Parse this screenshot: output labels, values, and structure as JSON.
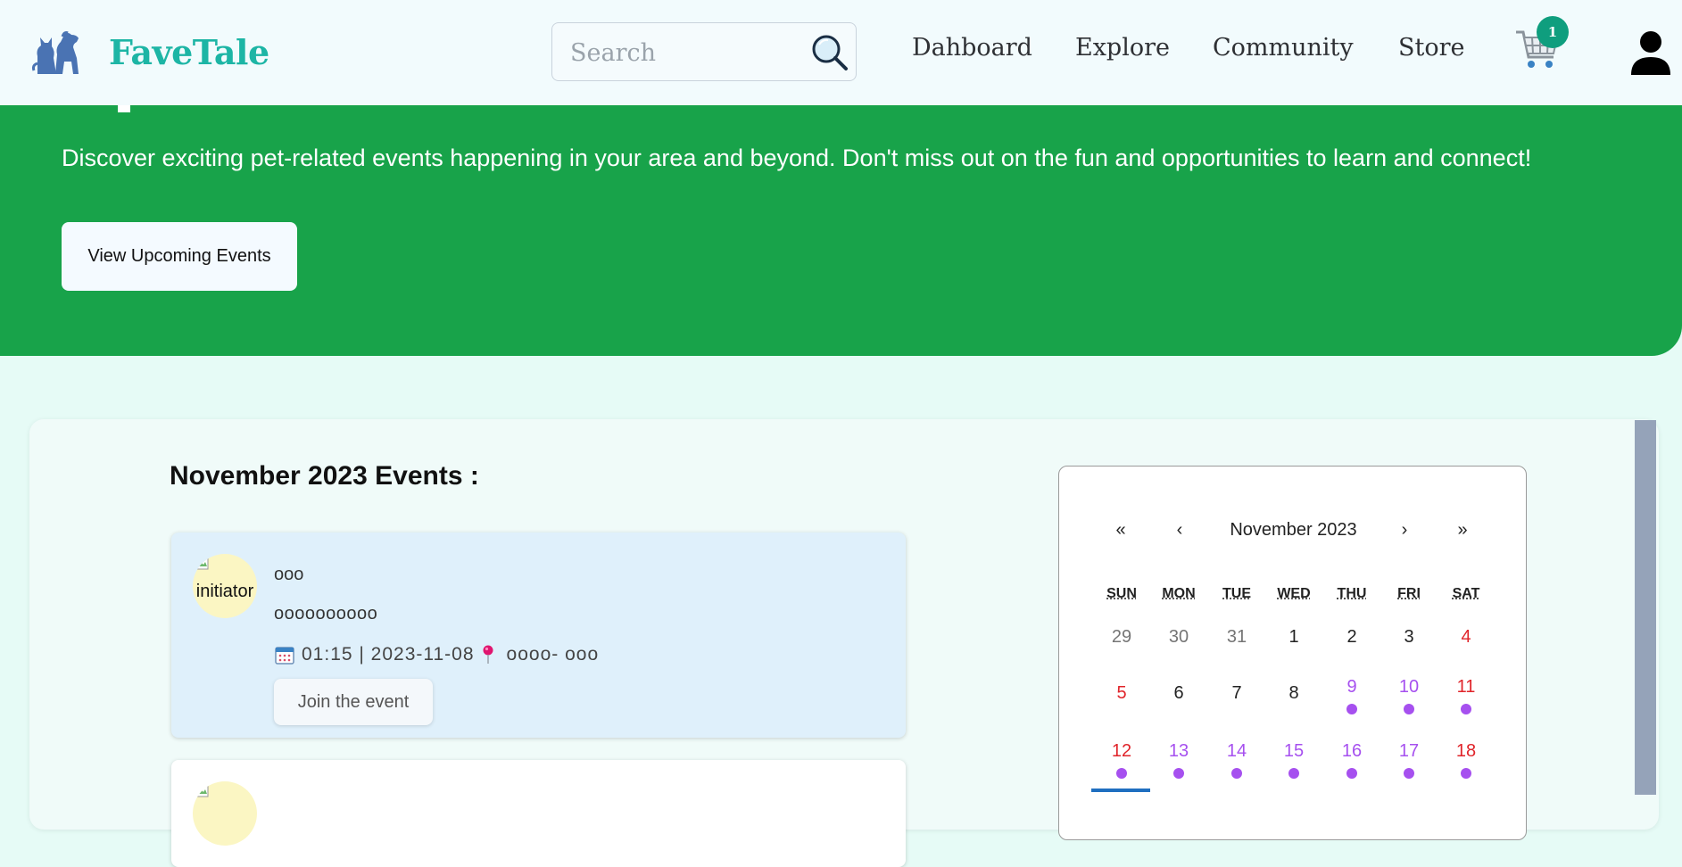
{
  "brand": {
    "name": "FaveTale"
  },
  "search": {
    "placeholder": "Search",
    "value": ""
  },
  "nav": {
    "links": [
      "Dahboard",
      "Explore",
      "Community",
      "Store"
    ]
  },
  "cart": {
    "count": "1"
  },
  "hero": {
    "description": "Discover exciting pet-related events happening in your area and beyond. Don't miss out on the fun and opportunities to learn and connect!",
    "button_label": "View Upcoming Events"
  },
  "events": {
    "heading": "November 2023 Events :",
    "items": [
      {
        "avatar_alt": "initiator",
        "title": "ooo",
        "description": "oooooooooo",
        "time": "01:15",
        "date": "2023-11-08",
        "time_date": "01:15 | 2023-11-08",
        "location": "oooo- ooo",
        "join_label": "Join the event"
      }
    ]
  },
  "calendar": {
    "month_label": "November 2023",
    "nav": {
      "prev_year": "«",
      "prev_month": "‹",
      "next_month": "›",
      "next_year": "»"
    },
    "weekdays": [
      "SUN",
      "MON",
      "TUE",
      "WED",
      "THU",
      "FRI",
      "SAT"
    ],
    "weeks": [
      [
        "29",
        "30",
        "31",
        "1",
        "2",
        "3",
        "4"
      ],
      [
        "5",
        "6",
        "7",
        "8",
        "9",
        "10",
        "11"
      ],
      [
        "12",
        "13",
        "14",
        "15",
        "16",
        "17",
        "18"
      ]
    ],
    "colors": {
      "weekend": "#e0242a",
      "event_day": "#a650ef",
      "muted": "#757575",
      "normal": "#222222"
    }
  },
  "colors": {
    "brand": "#1db5a5",
    "hero_bg": "#18a34a",
    "cart_badge": "#0f9e7e",
    "highlight_card": "#dff0fb"
  }
}
